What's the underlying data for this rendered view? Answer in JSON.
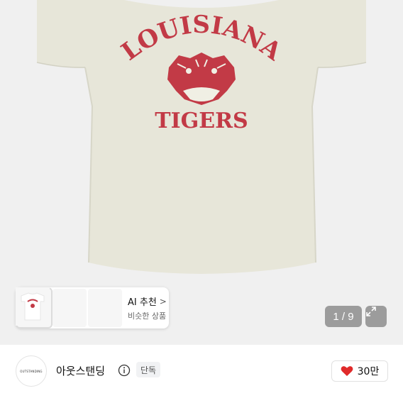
{
  "product": {
    "image_alt": "LOUISIANA TIGERS t-shirt",
    "print_top": "LOUISIANA",
    "print_bottom": "TIGERS"
  },
  "ai_recommend": {
    "title": "AI 추천",
    "subtitle": "비슷한 상품",
    "chevron": ">"
  },
  "gallery": {
    "counter": "1 / 9",
    "expand_icon": "expand-icon"
  },
  "shop": {
    "logo_text": "OUTSTANDING",
    "name": "아웃스탠딩",
    "info_icon": "info-icon",
    "badge": "단독",
    "likes": "30만",
    "like_icon": "heart-icon"
  },
  "colors": {
    "shirt": "#e7e6d9",
    "print": "#c23a46",
    "heart": "#e02a2a"
  }
}
